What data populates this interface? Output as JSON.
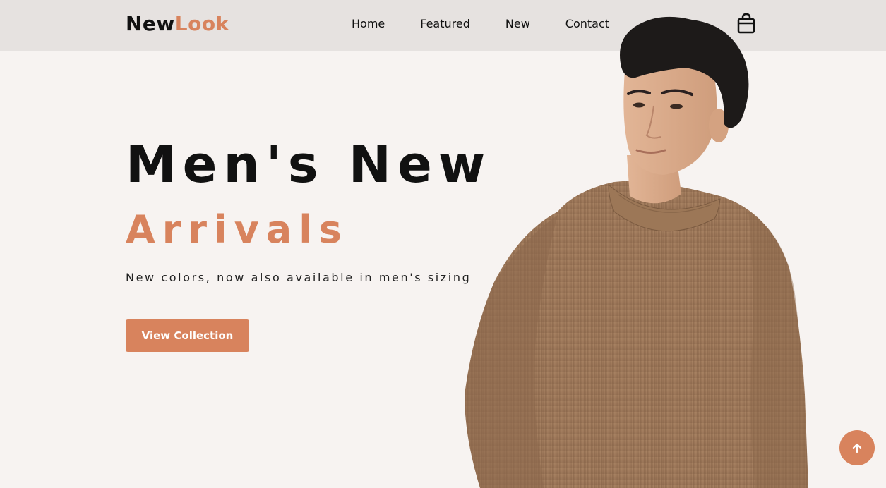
{
  "header": {
    "logo_part1": "New",
    "logo_part2": "Look",
    "nav": [
      {
        "label": "Home"
      },
      {
        "label": "Featured"
      },
      {
        "label": "New"
      },
      {
        "label": "Contact"
      }
    ],
    "cart_icon": "shopping-bag-icon"
  },
  "hero": {
    "title_line1": "Men's New",
    "title_line2": "Arrivals",
    "subtitle": "New colors, now also available in men's sizing",
    "cta_label": "View Collection",
    "image_icon": "model-photo"
  },
  "scroll_top": {
    "icon": "arrow-up-icon"
  },
  "colors": {
    "accent": "#d8835d",
    "header_bg": "#e6e2e0",
    "page_bg": "#f7f3f1",
    "text": "#111111"
  }
}
